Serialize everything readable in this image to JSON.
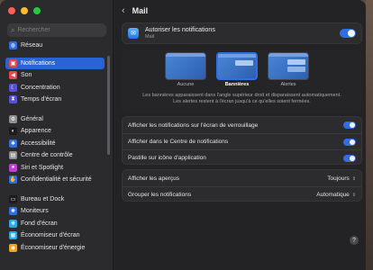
{
  "sidebar": {
    "search_placeholder": "Rechercher",
    "groups": [
      [
        {
          "label": "Réseau",
          "icon": "globe-icon",
          "color": "#2f6fe3",
          "glyph": "◍"
        }
      ],
      [
        {
          "label": "Notifications",
          "icon": "bell-icon",
          "color": "#e5484d",
          "glyph": "▣",
          "active": true
        },
        {
          "label": "Son",
          "icon": "speaker-icon",
          "color": "#e5484d",
          "glyph": "◀"
        },
        {
          "label": "Concentration",
          "icon": "moon-icon",
          "color": "#5b4fd6",
          "glyph": "☾"
        },
        {
          "label": "Temps d'écran",
          "icon": "hourglass-icon",
          "color": "#5b4fd6",
          "glyph": "⧗"
        }
      ],
      [
        {
          "label": "Général",
          "icon": "gear-icon",
          "color": "#8e8e93",
          "glyph": "⚙"
        },
        {
          "label": "Apparence",
          "icon": "appearance-icon",
          "color": "#1c1c1e",
          "glyph": "◐"
        },
        {
          "label": "Accessibilité",
          "icon": "accessibility-icon",
          "color": "#2f6fe3",
          "glyph": "✱"
        },
        {
          "label": "Centre de contrôle",
          "icon": "control-center-icon",
          "color": "#8e8e93",
          "glyph": "▤"
        },
        {
          "label": "Siri et Spotlight",
          "icon": "siri-icon",
          "color": "#c13dd6",
          "glyph": "●"
        },
        {
          "label": "Confidentialité et sécurité",
          "icon": "hand-icon",
          "color": "#2f6fe3",
          "glyph": "✋"
        }
      ],
      [
        {
          "label": "Bureau et Dock",
          "icon": "dock-icon",
          "color": "#1c1c1e",
          "glyph": "▭"
        },
        {
          "label": "Moniteurs",
          "icon": "display-icon",
          "color": "#2f6fe3",
          "glyph": "✺"
        },
        {
          "label": "Fond d'écran",
          "icon": "wallpaper-icon",
          "color": "#2aa8e8",
          "glyph": "❋"
        },
        {
          "label": "Économiseur d'écran",
          "icon": "screensaver-icon",
          "color": "#2aa8e8",
          "glyph": "▦"
        },
        {
          "label": "Économiseur d'énergie",
          "icon": "battery-icon",
          "color": "#f0a31b",
          "glyph": "◉"
        }
      ]
    ]
  },
  "header": {
    "title": "Mail"
  },
  "app_card": {
    "title": "Autoriser les notifications",
    "subtitle": "Mail",
    "enabled": true
  },
  "alert_styles": {
    "options": [
      {
        "label": "Aucune",
        "selected": false
      },
      {
        "label": "Bannières",
        "selected": true
      },
      {
        "label": "Alertes",
        "selected": false
      }
    ],
    "description_1": "Les bannières apparaissent dans l'angle supérieur droit et disparaissent automatiquement.",
    "description_2": "Les alertes restent à l'écran jusqu'à ce qu'elles soient fermées."
  },
  "toggles": [
    {
      "label": "Afficher les notifications sur l'écran de verrouillage",
      "on": true
    },
    {
      "label": "Afficher dans le Centre de notifications",
      "on": true
    },
    {
      "label": "Pastille sur icône d'application",
      "on": true
    }
  ],
  "selects": [
    {
      "label": "Afficher les aperçus",
      "value": "Toujours"
    },
    {
      "label": "Grouper les notifications",
      "value": "Automatique"
    }
  ],
  "help": {
    "label": "?"
  },
  "colors": {
    "accent": "#2f6fe3",
    "sidebar_bg": "#2b2a2c",
    "window_bg": "#232325"
  }
}
